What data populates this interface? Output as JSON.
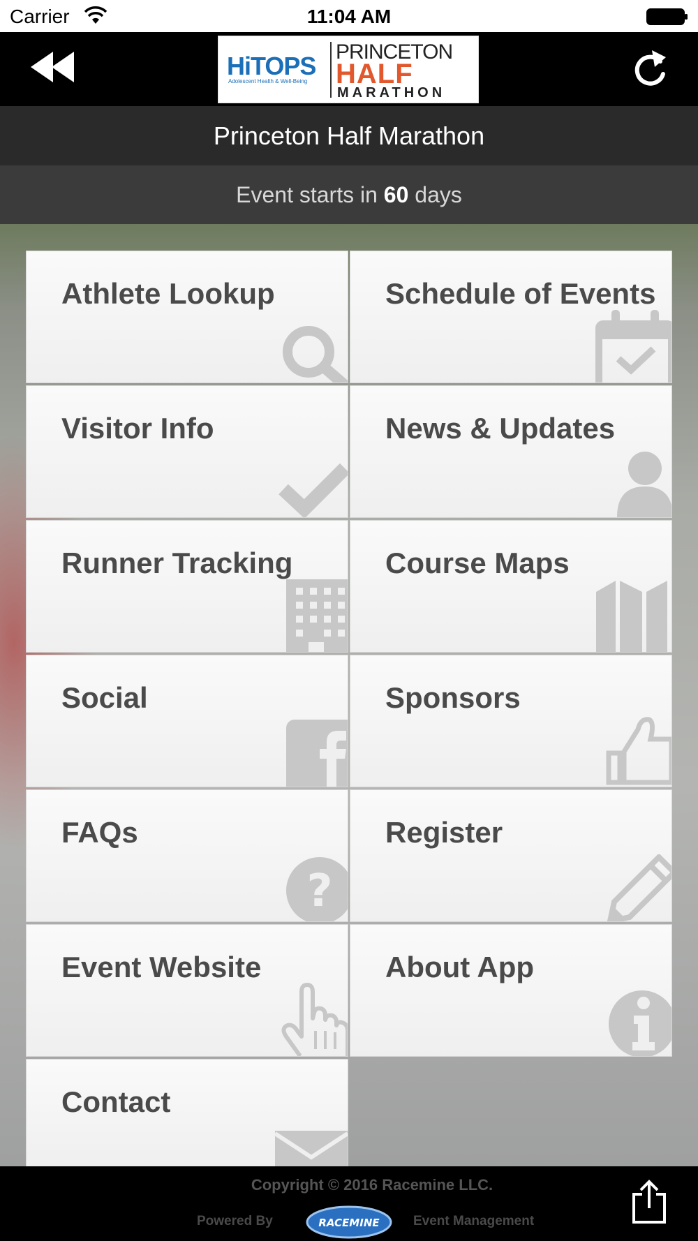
{
  "status_bar": {
    "carrier": "Carrier",
    "time": "11:04 AM"
  },
  "header": {
    "logo": {
      "left_text": "HiTOPS",
      "left_sub": "Adolescent Health & Well-Being",
      "right_line1": "PRINCETON",
      "right_line2": "HALF",
      "right_line3": "MARATHON"
    },
    "back_icon": "rewind-icon",
    "refresh_icon": "refresh-icon"
  },
  "title": "Princeton Half Marathon",
  "countdown": {
    "prefix": "Event starts in ",
    "days": "60",
    "suffix": " days"
  },
  "tiles": [
    {
      "label": "Athlete Lookup",
      "icon": "magnifier-icon"
    },
    {
      "label": "Schedule of Events",
      "icon": "calendar-check-icon"
    },
    {
      "label": "Visitor Info",
      "icon": "checkmark-icon"
    },
    {
      "label": "News & Updates",
      "icon": "person-icon"
    },
    {
      "label": "Runner Tracking",
      "icon": "building-icon"
    },
    {
      "label": "Course Maps",
      "icon": "map-icon"
    },
    {
      "label": "Social",
      "icon": "facebook-icon"
    },
    {
      "label": "Sponsors",
      "icon": "thumbs-up-icon"
    },
    {
      "label": "FAQs",
      "icon": "question-icon"
    },
    {
      "label": "Register",
      "icon": "pencil-icon"
    },
    {
      "label": "Event Website",
      "icon": "pointer-hand-icon"
    },
    {
      "label": "About App",
      "icon": "info-icon"
    },
    {
      "label": "Contact",
      "icon": "envelope-icon"
    }
  ],
  "footer": {
    "copyright": "Copyright © 2016 Racemine LLC.",
    "powered_by": "Powered By",
    "brand": "RACEMINE",
    "event_management": "Event Management",
    "share_icon": "share-icon"
  },
  "colors": {
    "header_bg": "#000000",
    "titlebar_bg": "#2a2a2a",
    "countdown_bg": "#3b3b3b",
    "tile_text": "#4a4a4a",
    "icon_gray": "#c7c7c7",
    "logo_blue": "#1b6fb8",
    "logo_orange": "#e2572b"
  }
}
